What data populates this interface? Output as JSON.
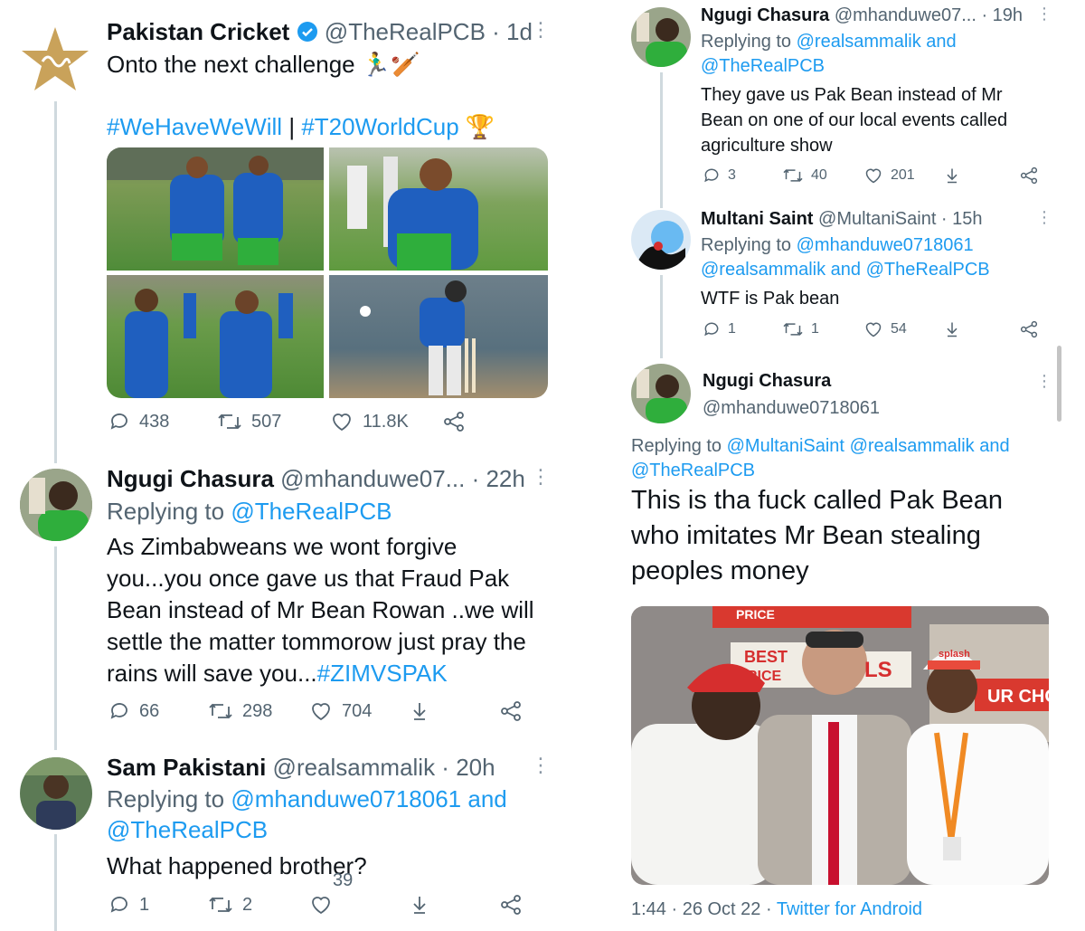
{
  "left": {
    "tweet": {
      "name": "Pakistan Cricket",
      "handle": "@TheRealPCB",
      "time": "· 1d",
      "text": "Onto the next challenge 🏃‍♂️🏏",
      "hashtag1": "#WeHaveWeWill",
      "separator": "|",
      "hashtag2": "#T20WorldCup 🏆",
      "replies": "438",
      "retweets": "507",
      "likes": "11.8K"
    },
    "reply1": {
      "name": "Ngugi Chasura",
      "handle": "@mhanduwe07...",
      "time": "· 22h",
      "replying_prefix": "Replying to",
      "replying_to": "@TheRealPCB",
      "text_lines": [
        "As Zimbabweans we wont forgive",
        "you...you once gave us that Fraud Pak",
        "Bean instead of Mr Bean Rowan ..we will",
        "settle the matter tommorow just pray the",
        "rains will save you..."
      ],
      "hashtag": "#ZIMVSPAK",
      "replies": "66",
      "retweets": "298",
      "likes": "704"
    },
    "reply2": {
      "name": "Sam Pakistani",
      "handle": "@realsammalik · 20h",
      "replying_prefix": "Replying to",
      "replying_to1": "@mhanduwe0718061",
      "and": "and",
      "replying_to2": "@TheRealPCB",
      "text": "What happened brother?",
      "replies": "1",
      "retweets": "2",
      "likes": "39"
    }
  },
  "right": {
    "reply3": {
      "name": "Ngugi Chasura",
      "handle": "@mhanduwe07...",
      "time": "· 19h",
      "replying_prefix": "Replying to",
      "replying_to1": "@realsammalik",
      "and": "and",
      "replying_to2": "@TheRealPCB",
      "text_lines": [
        "They gave us Pak Bean instead of Mr",
        "Bean on one of our local events called",
        "agriculture show"
      ],
      "replies": "3",
      "retweets": "40",
      "likes": "201"
    },
    "reply4": {
      "name": "Multani Saint",
      "handle": "@MultaniSaint · 15h",
      "replying_prefix": "Replying to",
      "replying_to1": "@mhanduwe0718061",
      "replying_to2": "@realsammalik",
      "and": "and",
      "replying_to3": "@TheRealPCB",
      "text": "WTF is Pak bean",
      "replies": "1",
      "retweets": "1",
      "likes": "54"
    },
    "focus": {
      "name": "Ngugi Chasura",
      "handle": "@mhanduwe0718061",
      "replying_prefix": "Replying to",
      "replying_to1": "@MultaniSaint",
      "replying_to2": "@realsammalik",
      "and": "and",
      "replying_to3": "@TheRealPCB",
      "text_lines": [
        "This is tha fuck called Pak Bean",
        "who imitates Mr Bean stealing",
        "peoples money"
      ],
      "photo_sign1": "PRICE",
      "photo_sign2": "BEST",
      "photo_sign3": "RICE",
      "photo_sign4": "LS",
      "photo_sign5": "UR CHO",
      "photo_cap": "splash",
      "timestamp": "1:44 · 26 Oct 22 ·",
      "source": "Twitter for Android"
    }
  },
  "colors": {
    "link": "#1d9bf0",
    "muted": "#536471",
    "verified": "#1d9bf0",
    "pitch_green": "#4c8f36",
    "kit_blue": "#1f5fbf",
    "kit_green": "#2fae3c"
  }
}
